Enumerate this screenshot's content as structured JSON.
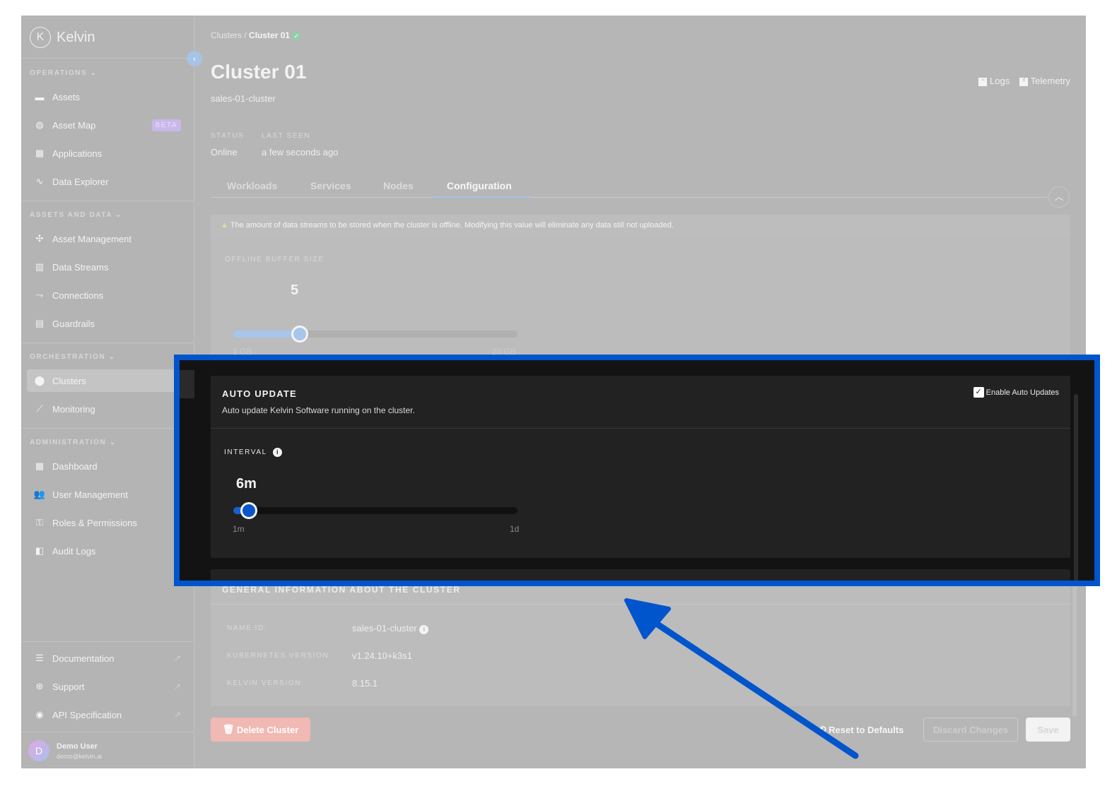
{
  "brand": "Kelvin",
  "sidebar": {
    "sections": [
      {
        "title": "OPERATIONS",
        "items": [
          {
            "label": "Assets",
            "icon": "assets-icon"
          },
          {
            "label": "Asset Map",
            "icon": "globe-icon",
            "badge": "BETA"
          },
          {
            "label": "Applications",
            "icon": "applications-icon"
          },
          {
            "label": "Data Explorer",
            "icon": "pulse-icon"
          }
        ]
      },
      {
        "title": "ASSETS AND DATA",
        "items": [
          {
            "label": "Asset Management",
            "icon": "asset-management-icon"
          },
          {
            "label": "Data Streams",
            "icon": "chart-icon"
          },
          {
            "label": "Connections",
            "icon": "connections-icon"
          },
          {
            "label": "Guardrails",
            "icon": "guardrails-icon"
          }
        ]
      },
      {
        "title": "ORCHESTRATION",
        "items": [
          {
            "label": "Clusters",
            "icon": "clusters-icon"
          },
          {
            "label": "Monitoring",
            "icon": "monitoring-icon"
          }
        ]
      },
      {
        "title": "ADMINISTRATION",
        "items": [
          {
            "label": "Dashboard",
            "icon": "dashboard-icon"
          },
          {
            "label": "User Management",
            "icon": "users-icon"
          },
          {
            "label": "Roles & Permissions",
            "icon": "roles-icon"
          },
          {
            "label": "Audit Logs",
            "icon": "audit-icon"
          }
        ]
      }
    ],
    "footer": [
      {
        "label": "Documentation"
      },
      {
        "label": "Support"
      },
      {
        "label": "API Specification"
      }
    ],
    "user": {
      "initial": "D",
      "name": "Demo User",
      "email": "demo@kelvin.ai"
    }
  },
  "breadcrumb": {
    "parent": "Clusters",
    "current": "Cluster 01"
  },
  "header": {
    "title": "Cluster 01",
    "subtitle": "sales-01-cluster",
    "logs": "Logs",
    "telemetry": "Telemetry",
    "status_label": "STATUS",
    "status": "Online",
    "last_seen_label": "LAST SEEN",
    "last_seen": "a few seconds ago"
  },
  "tabs": [
    "Workloads",
    "Services",
    "Nodes",
    "Configuration"
  ],
  "active_tab": "Configuration",
  "buffer": {
    "warning": "The amount of data streams to be stored when the cluster is offline. Modifying this value will eliminate any data still not uploaded.",
    "label": "OFFLINE BUFFER SIZE",
    "value": "5",
    "min": "1 GB",
    "max": "20 GB",
    "fraction": 0.21
  },
  "auto_update": {
    "title": "AUTO UPDATE",
    "description": "Auto update Kelvin Software running on the cluster.",
    "checkbox": "Enable Auto Updates",
    "checked": true,
    "interval_label": "INTERVAL",
    "value": "6m",
    "min": "1m",
    "max": "1d",
    "fraction": 0.03
  },
  "general": {
    "title": "GENERAL INFORMATION ABOUT THE CLUSTER",
    "rows": [
      {
        "k": "NAME ID:",
        "v": "sales-01-cluster"
      },
      {
        "k": "KUBERNETES VERSION:",
        "v": "v1.24.10+k3s1"
      },
      {
        "k": "KELVIN VERSION:",
        "v": "8.15.1"
      }
    ]
  },
  "actions": {
    "delete": "Delete Cluster",
    "reset": "Reset to Defaults",
    "discard": "Discard Changes",
    "save": "Save"
  }
}
